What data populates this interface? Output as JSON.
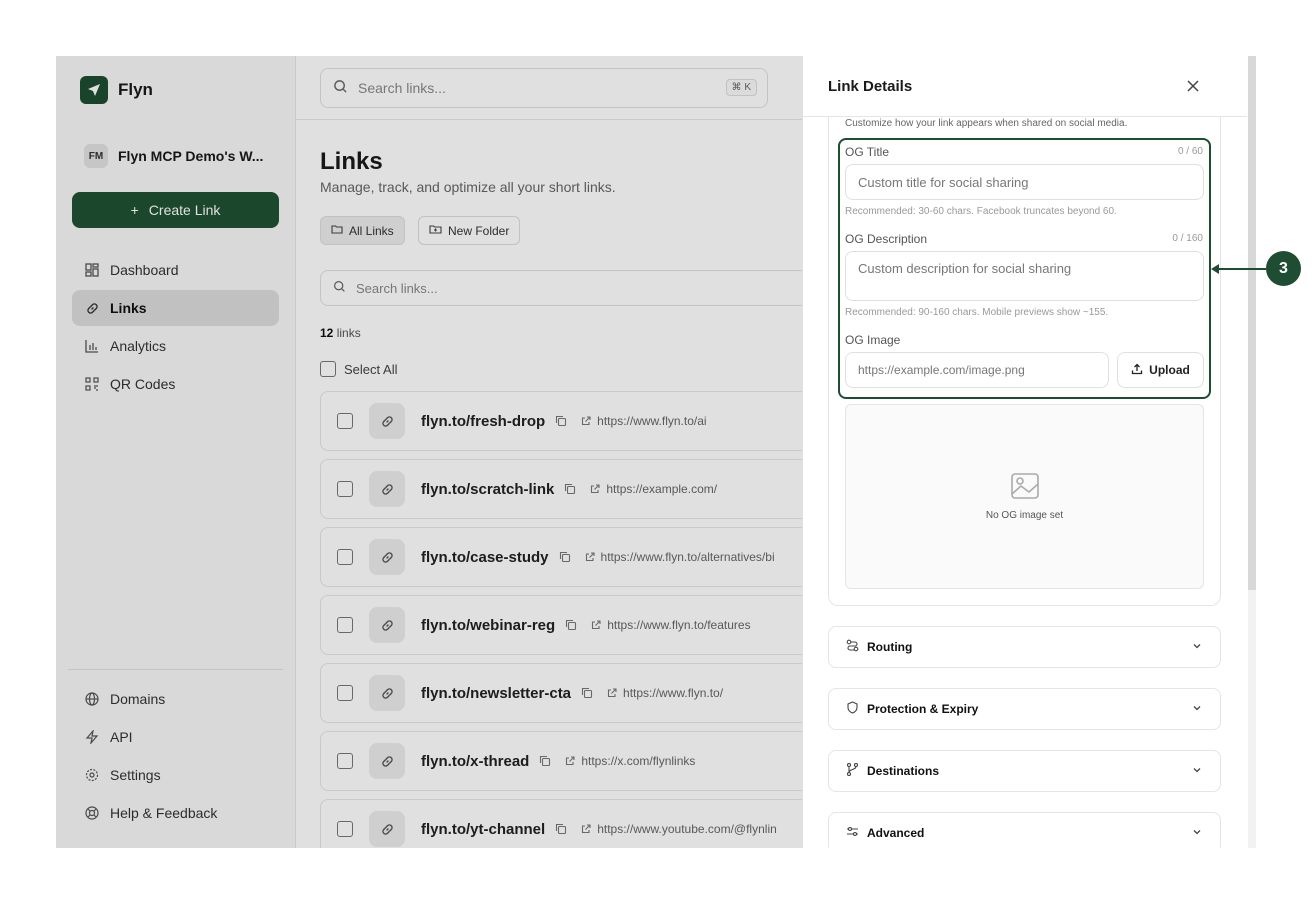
{
  "brand": {
    "name": "Flyn",
    "logo_icon": "paper-plane-icon"
  },
  "workspace": {
    "initials": "FM",
    "name": "Flyn MCP Demo's W..."
  },
  "sidebar": {
    "create_label": "Create Link",
    "items": [
      {
        "label": "Dashboard",
        "icon": "dashboard-icon"
      },
      {
        "label": "Links",
        "icon": "link-icon",
        "active": true
      },
      {
        "label": "Analytics",
        "icon": "analytics-icon"
      },
      {
        "label": "QR Codes",
        "icon": "qr-code-icon"
      }
    ],
    "bottom_items": [
      {
        "label": "Domains",
        "icon": "globe-icon"
      },
      {
        "label": "API",
        "icon": "lightning-icon"
      },
      {
        "label": "Settings",
        "icon": "gear-icon"
      },
      {
        "label": "Help & Feedback",
        "icon": "lifebuoy-icon"
      }
    ]
  },
  "topbar": {
    "search_placeholder": "Search links...",
    "shortcut": "⌘ K"
  },
  "main": {
    "title": "Links",
    "subtitle": "Manage, track, and optimize all your short links.",
    "all_links_label": "All Links",
    "new_folder_label": "New Folder",
    "search_placeholder": "Search links...",
    "count_number": "12",
    "count_suffix": "links",
    "select_all_label": "Select All",
    "links": [
      {
        "short": "flyn.to/fresh-drop",
        "dest": "https://www.flyn.to/ai"
      },
      {
        "short": "flyn.to/scratch-link",
        "dest": "https://example.com/"
      },
      {
        "short": "flyn.to/case-study",
        "dest": "https://www.flyn.to/alternatives/bi"
      },
      {
        "short": "flyn.to/webinar-reg",
        "dest": "https://www.flyn.to/features"
      },
      {
        "short": "flyn.to/newsletter-cta",
        "dest": "https://www.flyn.to/"
      },
      {
        "short": "flyn.to/x-thread",
        "dest": "https://x.com/flynlinks"
      },
      {
        "short": "flyn.to/yt-channel",
        "dest": "https://www.youtube.com/@flynlin"
      }
    ]
  },
  "panel": {
    "title": "Link Details",
    "og_description_text": "Customize how your link appears when shared on social media.",
    "og_title": {
      "label": "OG Title",
      "count": "0 / 60",
      "placeholder": "Custom title for social sharing",
      "hint": "Recommended: 30-60 chars. Facebook truncates beyond 60."
    },
    "og_desc": {
      "label": "OG Description",
      "count": "0 / 160",
      "placeholder": "Custom description for social sharing",
      "hint": "Recommended: 90-160 chars. Mobile previews show ~155."
    },
    "og_image": {
      "label": "OG Image",
      "placeholder": "https://example.com/image.png",
      "upload_label": "Upload",
      "empty_text": "No OG image set"
    },
    "sections": [
      {
        "label": "Routing",
        "icon": "routing-icon"
      },
      {
        "label": "Protection & Expiry",
        "icon": "shield-icon"
      },
      {
        "label": "Destinations",
        "icon": "branch-icon"
      },
      {
        "label": "Advanced",
        "icon": "sliders-icon"
      }
    ]
  },
  "callout": {
    "number": "3"
  },
  "colors": {
    "brand": "#1e4d33",
    "highlight": "#1e4d33"
  }
}
